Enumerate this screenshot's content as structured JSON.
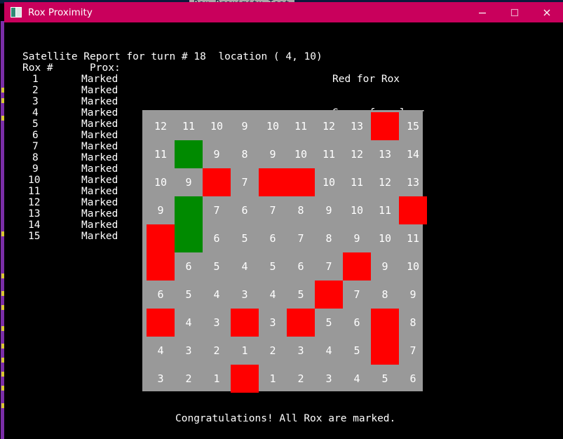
{
  "background_window": {
    "title_fragment": "Rox Proximity Test",
    "strip_color": "#0d1a3c",
    "title_bg": "#a8a8a8",
    "left_edge_color": "#7b2ea8",
    "left_edge_tick_color": "#d8c832"
  },
  "window": {
    "title": "Rox Proximity",
    "titlebar_color": "#c9005c",
    "icon": "window-app-icon",
    "controls": [
      {
        "name": "minimize",
        "glyph": "minimize-icon"
      },
      {
        "name": "maximize",
        "glyph": "maximize-icon"
      },
      {
        "name": "close",
        "glyph": "close-icon"
      }
    ]
  },
  "console": {
    "background": "#000000",
    "foreground": "#ffffff",
    "report_header": "Satellite Report for turn # 18  location ( 4, 10)",
    "column_headers": "Rox #      Prox:",
    "legend": {
      "red": "Red for Rox",
      "green": "Green for clear"
    },
    "status_message": "Congratulations! All Rox are marked.",
    "rox_entries": [
      {
        "id": "1",
        "status": "Marked"
      },
      {
        "id": "2",
        "status": "Marked"
      },
      {
        "id": "3",
        "status": "Marked"
      },
      {
        "id": "4",
        "status": "Marked"
      },
      {
        "id": "5",
        "status": "Marked"
      },
      {
        "id": "6",
        "status": "Marked"
      },
      {
        "id": "7",
        "status": "Marked"
      },
      {
        "id": "8",
        "status": "Marked"
      },
      {
        "id": "9",
        "status": "Marked"
      },
      {
        "id": "10",
        "status": "Marked"
      },
      {
        "id": "11",
        "status": "Marked"
      },
      {
        "id": "12",
        "status": "Marked"
      },
      {
        "id": "13",
        "status": "Marked"
      },
      {
        "id": "14",
        "status": "Marked"
      },
      {
        "id": "15",
        "status": "Marked"
      }
    ]
  },
  "board": {
    "rows": 10,
    "cols": 10,
    "cell_size": 40,
    "background": "#999999",
    "marker_red": "#ff0000",
    "marker_green": "#008a00",
    "numbers": [
      [
        "12",
        "11",
        "10",
        "9",
        "10",
        "11",
        "12",
        "13",
        "",
        "15"
      ],
      [
        "11",
        "",
        "9",
        "8",
        "9",
        "10",
        "11",
        "12",
        "13",
        "14"
      ],
      [
        "10",
        "9",
        "",
        "7",
        "",
        "",
        "10",
        "11",
        "12",
        "13"
      ],
      [
        "9",
        "",
        "7",
        "6",
        "7",
        "8",
        "9",
        "10",
        "11",
        ""
      ],
      [
        "",
        "",
        "6",
        "5",
        "6",
        "7",
        "8",
        "9",
        "10",
        "11"
      ],
      [
        "",
        "6",
        "5",
        "4",
        "5",
        "6",
        "7",
        "",
        "9",
        "10"
      ],
      [
        "6",
        "5",
        "4",
        "3",
        "4",
        "5",
        "",
        "7",
        "8",
        "9"
      ],
      [
        "",
        "4",
        "3",
        "",
        "3",
        "",
        "5",
        "6",
        "",
        "8"
      ],
      [
        "4",
        "3",
        "2",
        "1",
        "2",
        "3",
        "4",
        "5",
        "",
        "7"
      ],
      [
        "3",
        "2",
        "1",
        "",
        "1",
        "2",
        "3",
        "4",
        "5",
        "6"
      ]
    ],
    "markers": [
      {
        "color": "red",
        "col": 9,
        "row": 1,
        "w": 1,
        "h": 1
      },
      {
        "color": "green",
        "col": 2,
        "row": 2,
        "w": 1,
        "h": 1
      },
      {
        "color": "red",
        "col": 3,
        "row": 3,
        "w": 1,
        "h": 1
      },
      {
        "color": "red",
        "col": 5,
        "row": 3,
        "w": 2,
        "h": 1
      },
      {
        "color": "green",
        "col": 2,
        "row": 4,
        "w": 1,
        "h": 2
      },
      {
        "color": "red",
        "col": 10,
        "row": 4,
        "w": 1,
        "h": 1
      },
      {
        "color": "red",
        "col": 1,
        "row": 5,
        "w": 1,
        "h": 2
      },
      {
        "color": "red",
        "col": 8,
        "row": 6,
        "w": 1,
        "h": 1
      },
      {
        "color": "red",
        "col": 7,
        "row": 7,
        "w": 1,
        "h": 1
      },
      {
        "color": "red",
        "col": 1,
        "row": 8,
        "w": 1,
        "h": 1
      },
      {
        "color": "red",
        "col": 4,
        "row": 8,
        "w": 1,
        "h": 1
      },
      {
        "color": "red",
        "col": 6,
        "row": 8,
        "w": 1,
        "h": 1
      },
      {
        "color": "red",
        "col": 9,
        "row": 8,
        "w": 1,
        "h": 2
      },
      {
        "color": "red",
        "col": 4,
        "row": 10,
        "w": 1,
        "h": 1
      }
    ]
  }
}
